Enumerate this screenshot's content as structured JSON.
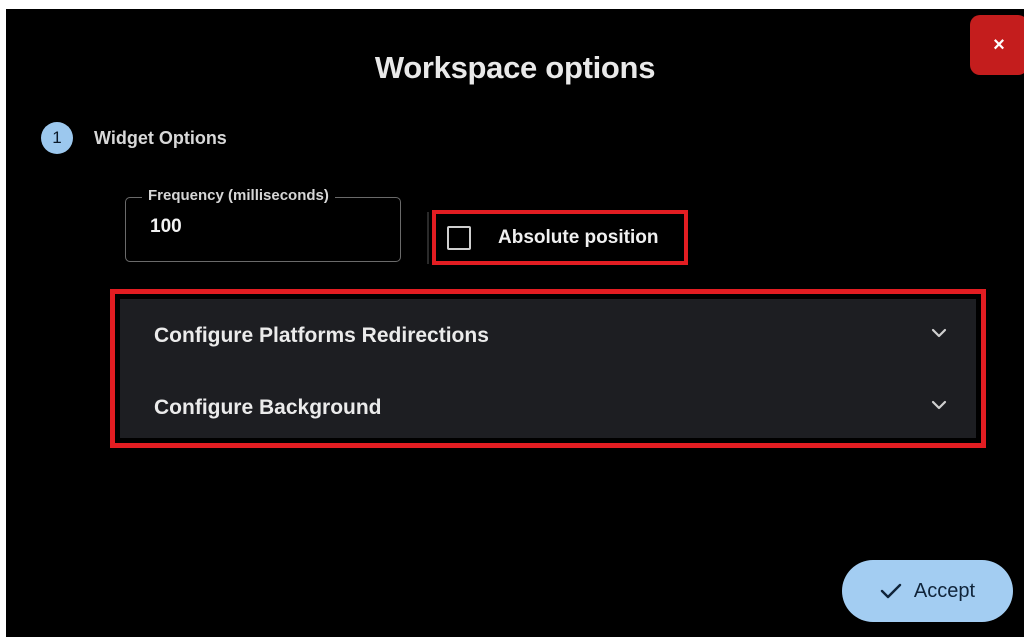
{
  "dialog": {
    "title": "Workspace options",
    "close_label": "×"
  },
  "step": {
    "number": "1",
    "label": "Widget Options"
  },
  "frequency": {
    "label": "Frequency (milliseconds)",
    "value": "100"
  },
  "absolute_position": {
    "label": "Absolute position",
    "checked": false
  },
  "accordion": {
    "items": [
      {
        "label": "Configure Platforms Redirections",
        "icon": "chevron-down-icon",
        "expanded": false
      },
      {
        "label": "Configure Background",
        "icon": "chevron-down-icon",
        "expanded": false
      }
    ]
  },
  "footer": {
    "accept_label": "Accept",
    "accept_icon": "check-icon"
  },
  "colors": {
    "highlight": "#e21d22",
    "close_button": "#c41d1d",
    "accent": "#a3cdf2",
    "background": "#000000"
  }
}
